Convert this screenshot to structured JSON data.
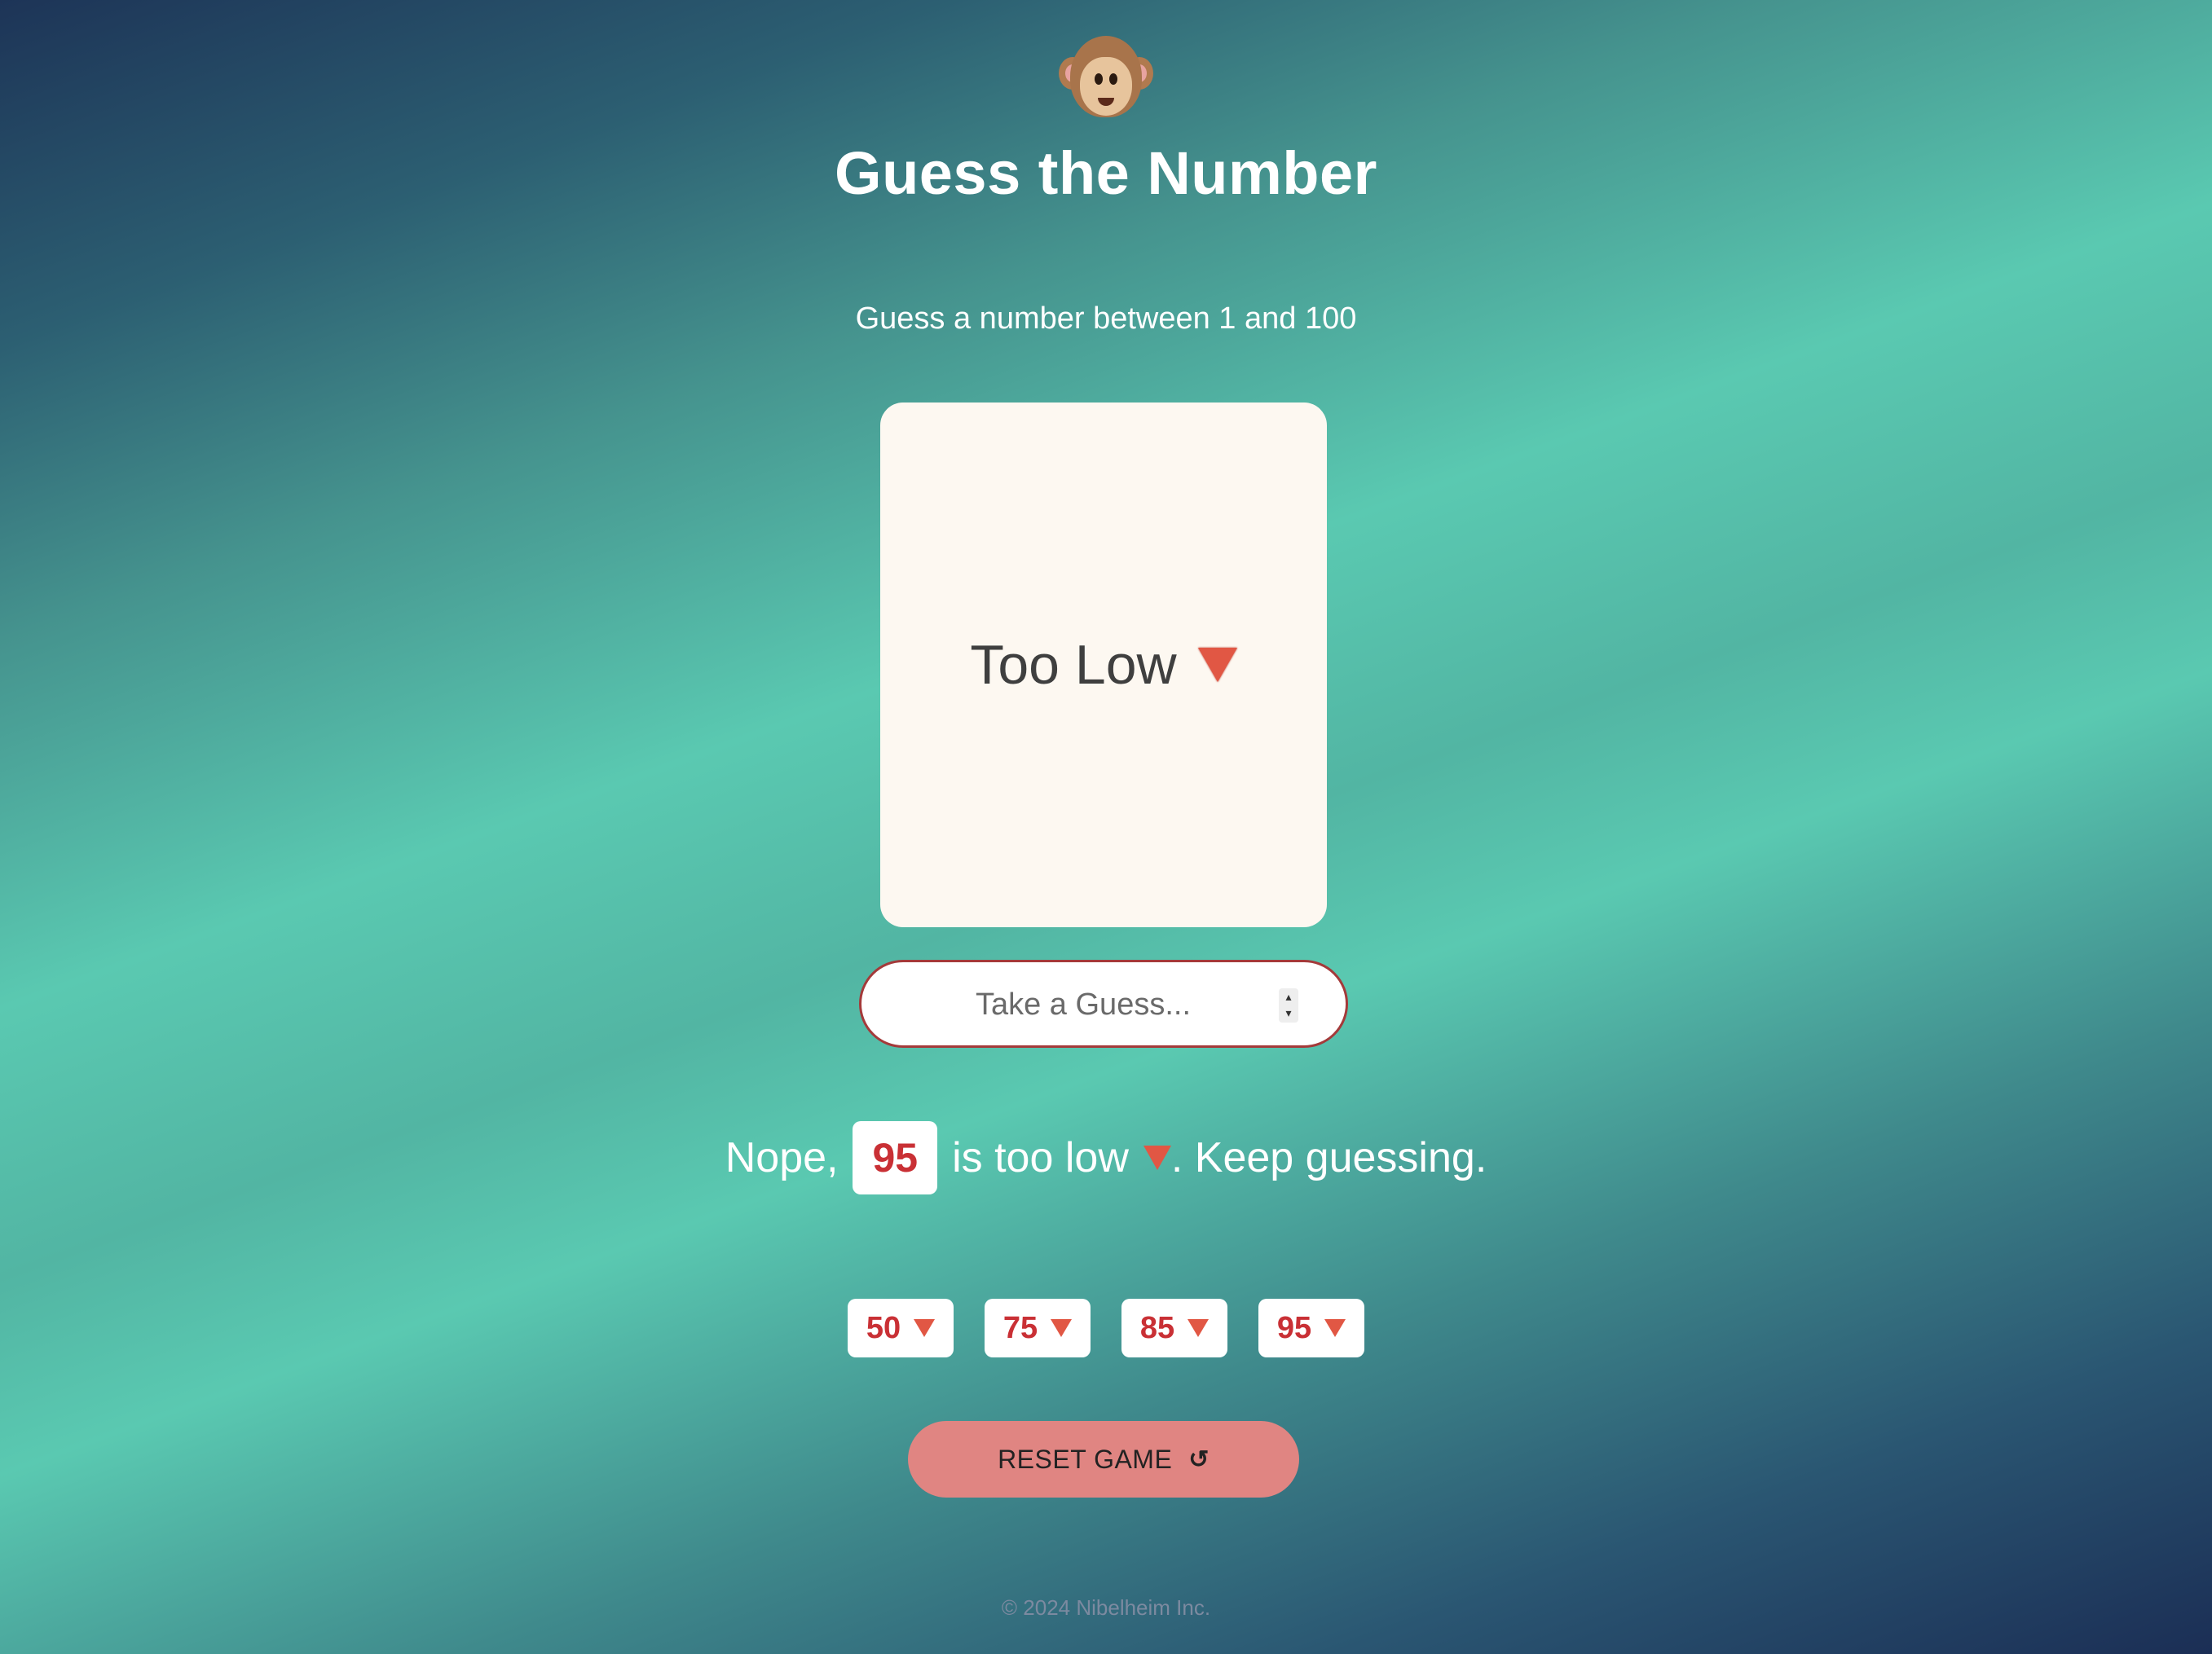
{
  "header": {
    "logo_icon": "monkey-face-icon",
    "title": "Guess the Number",
    "subtitle": "Guess a number between 1 and 100"
  },
  "card": {
    "status_text": "Too Low",
    "status_icon": "red-down-triangle-icon"
  },
  "guess_input": {
    "placeholder": "Take a Guess...",
    "value": ""
  },
  "feedback": {
    "prefix": "Nope,",
    "number": "95",
    "middle": "is too low",
    "suffix": ". Keep guessing."
  },
  "history": [
    {
      "value": "50",
      "direction": "low"
    },
    {
      "value": "75",
      "direction": "low"
    },
    {
      "value": "85",
      "direction": "low"
    },
    {
      "value": "95",
      "direction": "low"
    }
  ],
  "reset": {
    "label": "RESET GAME",
    "icon": "↺"
  },
  "footer": {
    "text": "© 2024 Nibelheim Inc."
  },
  "colors": {
    "accent_red": "#c93035",
    "triangle_red": "#e15744",
    "reset_button": "#e08582",
    "card_bg": "#fdf8f1"
  }
}
